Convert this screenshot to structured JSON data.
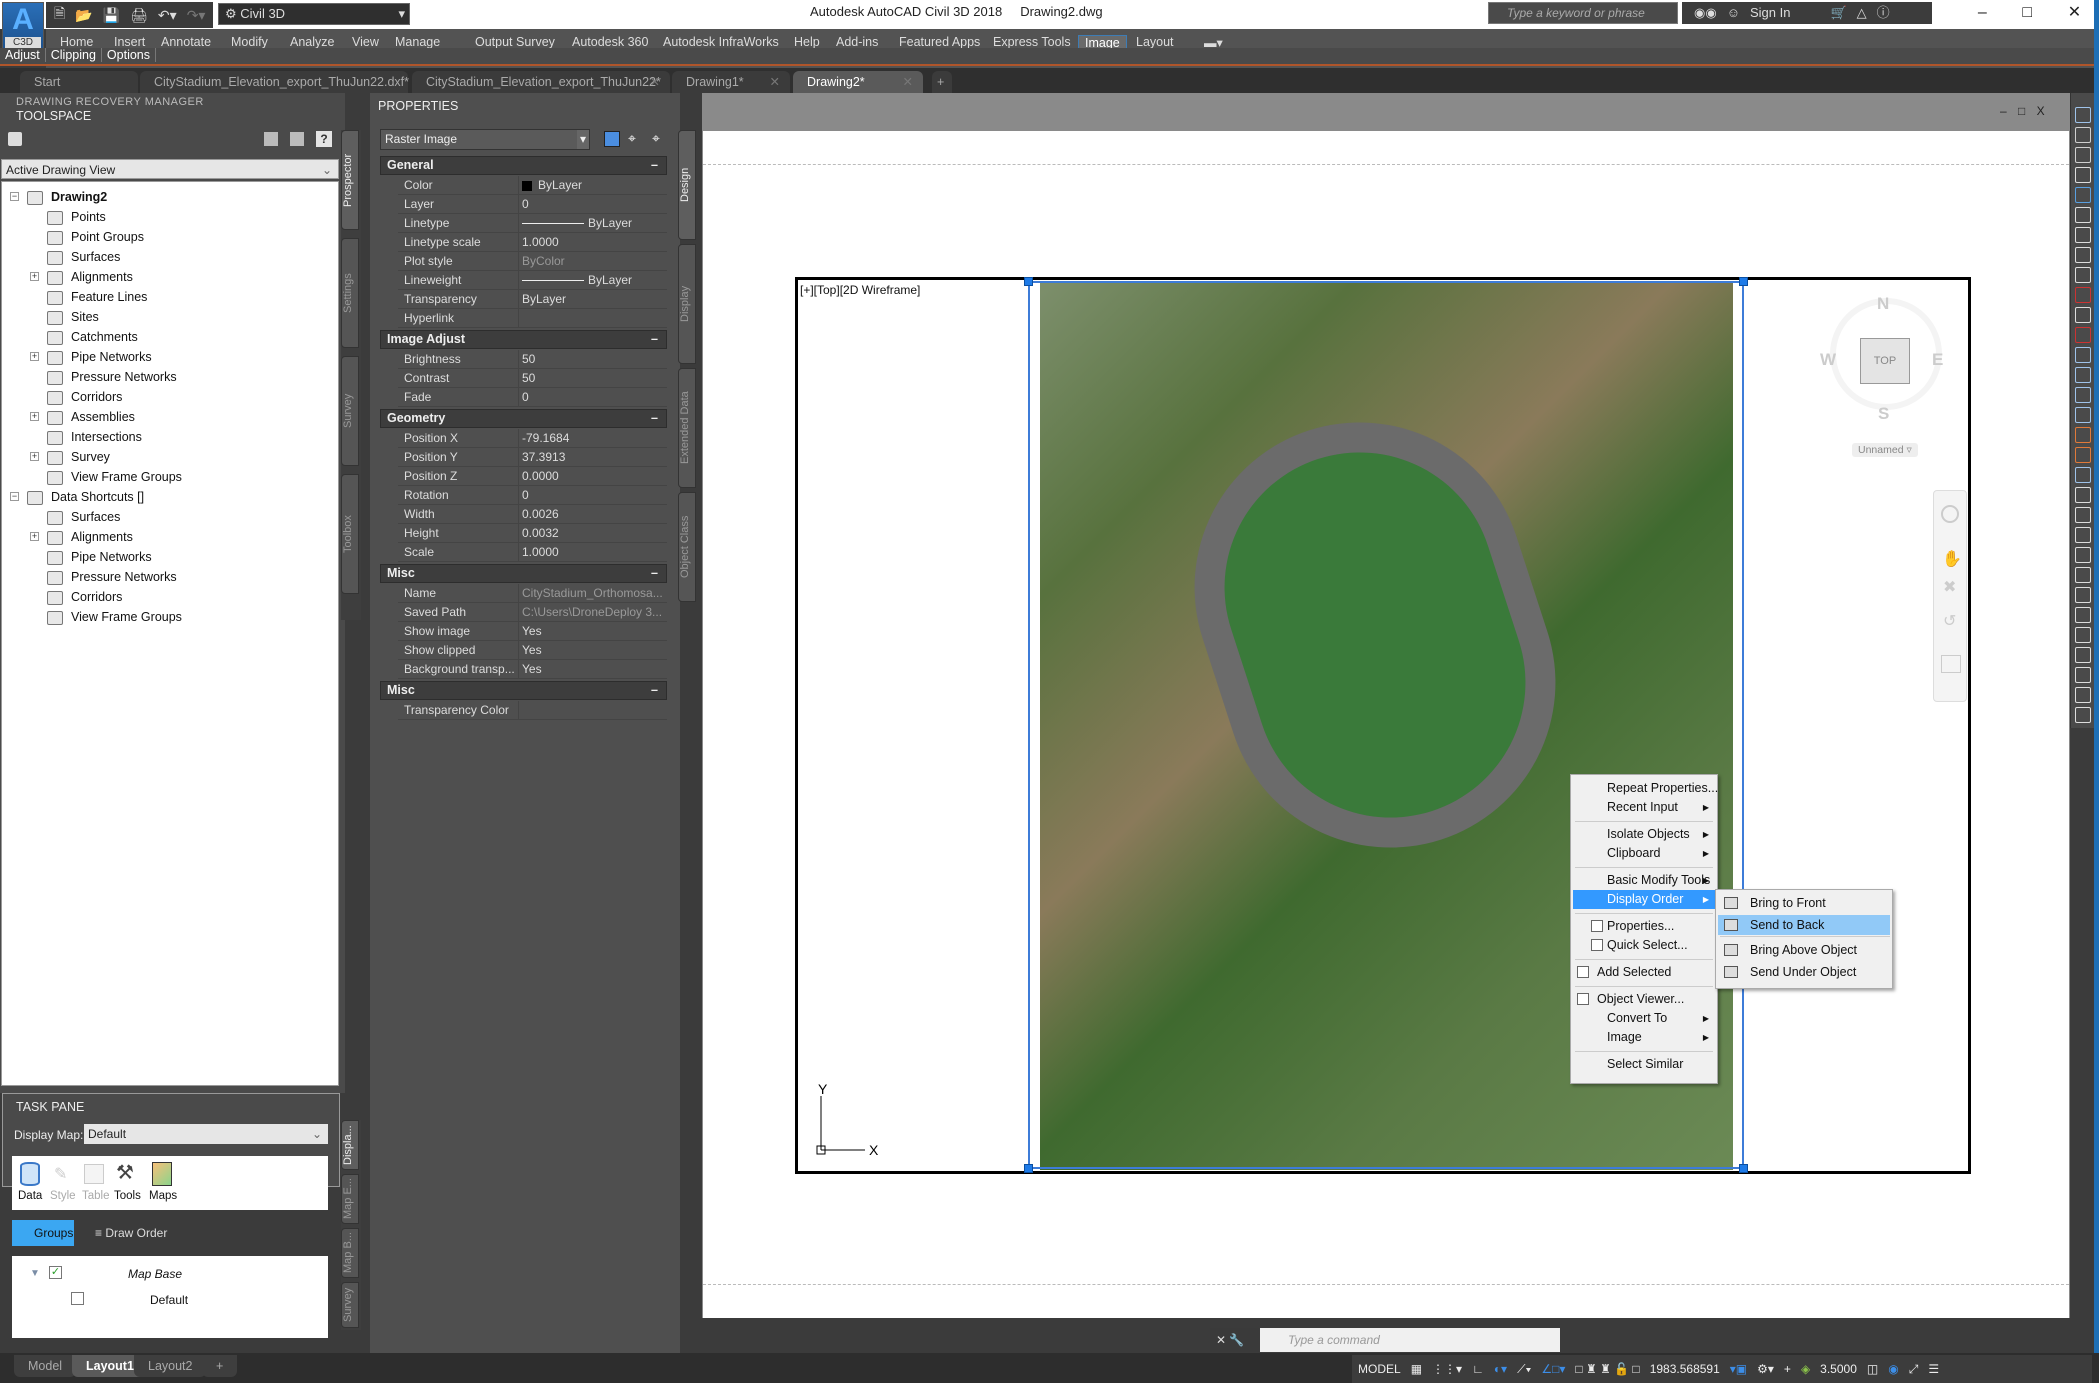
{
  "app": {
    "title": "Autodesk AutoCAD Civil 3D 2018",
    "document": "Drawing2.dwg",
    "app_badge": "C3D",
    "workspace": "Civil 3D",
    "search_placeholder": "Type a keyword or phrase",
    "sign_in": "Sign In"
  },
  "ribbon": {
    "tabs": [
      "Home",
      "Insert",
      "Annotate",
      "Modify",
      "Analyze",
      "View",
      "Manage",
      "Output",
      "Survey",
      "Autodesk 360",
      "Autodesk InfraWorks",
      "Help",
      "Add-ins",
      "Featured Apps",
      "Express Tools",
      "Image",
      "Layout"
    ],
    "active_tab": "Image",
    "panels": [
      "Adjust",
      "Clipping",
      "Options"
    ]
  },
  "file_tabs": [
    {
      "label": "Start",
      "closable": false,
      "active": false
    },
    {
      "label": "CityStadium_Elevation_export_ThuJun22.dxf*",
      "closable": true,
      "active": false
    },
    {
      "label": "CityStadium_Elevation_export_ThuJun22*",
      "closable": true,
      "active": false
    },
    {
      "label": "Drawing1*",
      "closable": true,
      "active": false
    },
    {
      "label": "Drawing2*",
      "closable": true,
      "active": true
    }
  ],
  "toolspace": {
    "recovery_header": "DRAWING RECOVERY MANAGER",
    "title": "TOOLSPACE",
    "view_select": "Active Drawing View",
    "tree": {
      "drawing": "Drawing2",
      "drawing_items": [
        "Points",
        "Point Groups",
        "Surfaces",
        "Alignments",
        "Feature Lines",
        "Sites",
        "Catchments",
        "Pipe Networks",
        "Pressure Networks",
        "Corridors",
        "Assemblies",
        "Intersections",
        "Survey",
        "View Frame Groups"
      ],
      "shortcuts": "Data Shortcuts []",
      "shortcut_items": [
        "Surfaces",
        "Alignments",
        "Pipe Networks",
        "Pressure Networks",
        "Corridors",
        "View Frame Groups"
      ]
    },
    "side_tabs": [
      "Prospector",
      "Settings",
      "Survey",
      "Toolbox"
    ]
  },
  "properties": {
    "title": "PROPERTIES",
    "object_type": "Raster Image",
    "side_tabs": [
      "Design",
      "Display",
      "Extended Data",
      "Object Class"
    ],
    "sections": [
      {
        "name": "General",
        "rows": [
          {
            "k": "Color",
            "v": "ByLayer"
          },
          {
            "k": "Layer",
            "v": "0"
          },
          {
            "k": "Linetype",
            "v": "ByLayer"
          },
          {
            "k": "Linetype scale",
            "v": "1.0000"
          },
          {
            "k": "Plot style",
            "v": "ByColor"
          },
          {
            "k": "Lineweight",
            "v": "ByLayer"
          },
          {
            "k": "Transparency",
            "v": "ByLayer"
          },
          {
            "k": "Hyperlink",
            "v": ""
          }
        ]
      },
      {
        "name": "Image Adjust",
        "rows": [
          {
            "k": "Brightness",
            "v": "50"
          },
          {
            "k": "Contrast",
            "v": "50"
          },
          {
            "k": "Fade",
            "v": "0"
          }
        ]
      },
      {
        "name": "Geometry",
        "rows": [
          {
            "k": "Position X",
            "v": "-79.1684"
          },
          {
            "k": "Position Y",
            "v": "37.3913"
          },
          {
            "k": "Position Z",
            "v": "0.0000"
          },
          {
            "k": "Rotation",
            "v": "0"
          },
          {
            "k": "Width",
            "v": "0.0026"
          },
          {
            "k": "Height",
            "v": "0.0032"
          },
          {
            "k": "Scale",
            "v": "1.0000"
          }
        ]
      },
      {
        "name": "Misc",
        "rows": [
          {
            "k": "Name",
            "v": "CityStadium_Orthomosa..."
          },
          {
            "k": "Saved Path",
            "v": "C:\\Users\\DroneDeploy 3..."
          },
          {
            "k": "Show image",
            "v": "Yes"
          },
          {
            "k": "Show clipped",
            "v": "Yes"
          },
          {
            "k": "Background transp...",
            "v": "Yes"
          }
        ]
      },
      {
        "name": "Misc",
        "rows": [
          {
            "k": "Transparency Color",
            "v": ""
          }
        ]
      }
    ]
  },
  "viewport": {
    "label": "[+][Top][2D Wireframe]",
    "viewcube": {
      "top": "TOP",
      "n": "N",
      "s": "S",
      "e": "E",
      "w": "W",
      "ucs_name": "Unnamed"
    },
    "ucs": {
      "x": "X",
      "y": "Y"
    },
    "window_controls": "– □ X"
  },
  "context_menu": {
    "items": [
      {
        "label": "Repeat Properties...",
        "submenu": false
      },
      {
        "label": "Recent Input",
        "submenu": true
      },
      {
        "label": "Isolate Objects",
        "submenu": true
      },
      {
        "label": "Clipboard",
        "submenu": true
      },
      {
        "label": "Basic Modify Tools",
        "submenu": true
      },
      {
        "label": "Display Order",
        "submenu": true,
        "highlighted": true
      },
      {
        "label": "Properties...",
        "submenu": false
      },
      {
        "label": "Quick Select...",
        "submenu": false
      },
      {
        "label": "Add Selected",
        "submenu": false
      },
      {
        "label": "Object Viewer...",
        "submenu": false
      },
      {
        "label": "Convert To",
        "submenu": true
      },
      {
        "label": "Image",
        "submenu": true
      },
      {
        "label": "Select Similar",
        "submenu": false
      }
    ],
    "submenu": [
      {
        "label": "Bring to Front"
      },
      {
        "label": "Send to Back",
        "highlighted": true
      },
      {
        "label": "Bring Above Object"
      },
      {
        "label": "Send Under Object"
      }
    ]
  },
  "command_line": {
    "placeholder": "Type a command"
  },
  "task_pane": {
    "title": "TASK PANE",
    "display_map_label": "Display Map:",
    "display_map": "Default",
    "tools": [
      {
        "label": "Data",
        "enabled": true
      },
      {
        "label": "Style",
        "enabled": false
      },
      {
        "label": "Table",
        "enabled": false
      },
      {
        "label": "Tools",
        "enabled": true
      },
      {
        "label": "Maps",
        "enabled": true
      }
    ],
    "groups_btn": "Groups",
    "draw_order_btn": "Draw Order",
    "layers": [
      {
        "label": "Map Base",
        "checked": true
      },
      {
        "label": "Default",
        "checked": false
      }
    ],
    "side_tabs": [
      "Displa...",
      "Map E...",
      "Map B...",
      "Survey"
    ]
  },
  "layout_tabs": [
    {
      "label": "Model",
      "active": false
    },
    {
      "label": "Layout1",
      "active": true
    },
    {
      "label": "Layout2",
      "active": false
    },
    {
      "label": "+",
      "active": false
    }
  ],
  "status_bar": {
    "space": "MODEL",
    "coordinate": "1983.568591",
    "scale": "3.5000"
  }
}
